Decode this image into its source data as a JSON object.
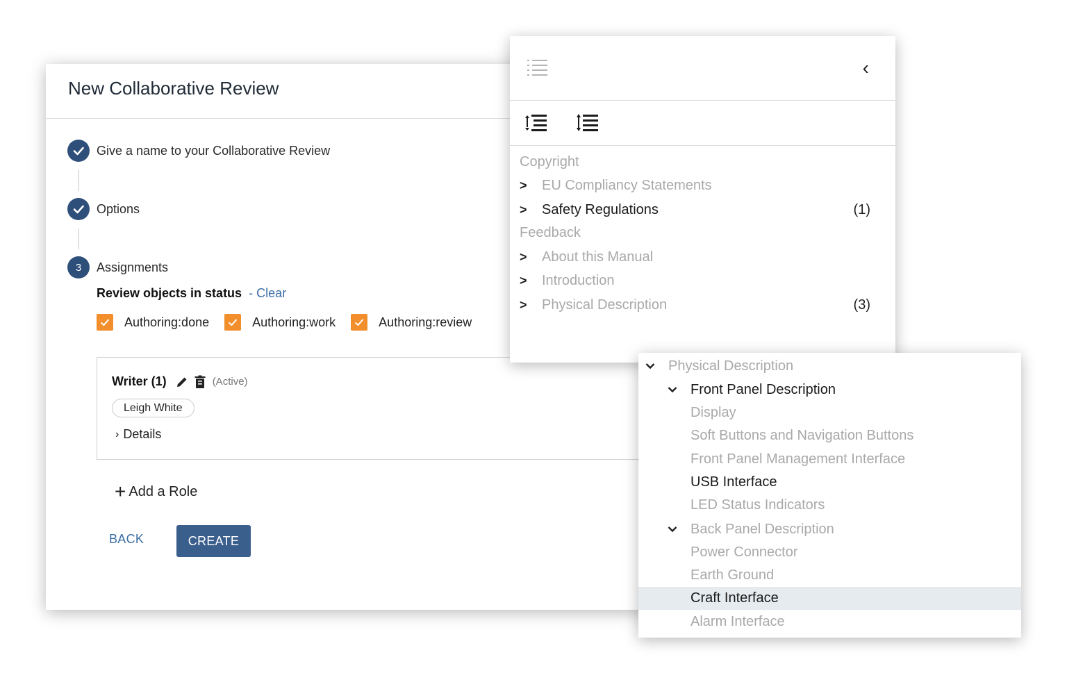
{
  "dialog": {
    "title": "New Collaborative Review",
    "steps": [
      {
        "label": "Give a name to your Collaborative Review",
        "state": "done"
      },
      {
        "label": "Options",
        "state": "done"
      },
      {
        "label": "Assignments",
        "state": "current",
        "number": "3"
      }
    ],
    "status_filter": {
      "label": "Review objects in status",
      "clear": "- Clear",
      "options": [
        {
          "label": "Authoring:done",
          "checked": true
        },
        {
          "label": "Authoring:work",
          "checked": true
        },
        {
          "label": "Authoring:review",
          "checked": true
        }
      ]
    },
    "role": {
      "title": "Writer (1)",
      "state": "(Active)",
      "assignee": "Leigh White",
      "details": "Details"
    },
    "add_role": "Add a Role",
    "back": "BACK",
    "create": "CREATE",
    "accent_color": "#2e4f7a",
    "checkbox_color": "#f28f2c"
  },
  "toc": {
    "icons": [
      "list-icon",
      "collapse-left-icon",
      "decrease-indent-icon",
      "increase-indent-icon"
    ],
    "items": [
      {
        "label": "Copyright",
        "level": 0,
        "style": "muted",
        "expandable": false,
        "count": ""
      },
      {
        "label": "EU Compliancy Statements",
        "level": 1,
        "style": "muted",
        "expandable": true,
        "count": ""
      },
      {
        "label": "Safety Regulations",
        "level": 1,
        "style": "dark",
        "expandable": true,
        "count": "(1)"
      },
      {
        "label": "Feedback",
        "level": 0,
        "style": "muted",
        "expandable": false,
        "count": ""
      },
      {
        "label": "About this Manual",
        "level": 1,
        "style": "muted",
        "expandable": true,
        "count": ""
      },
      {
        "label": "Introduction",
        "level": 1,
        "style": "muted",
        "expandable": true,
        "count": ""
      },
      {
        "label": "Physical Description",
        "level": 1,
        "style": "muted",
        "expandable": true,
        "count": "(3)"
      }
    ]
  },
  "subtree": {
    "items": [
      {
        "label": "Physical Description",
        "level": 0,
        "style": "muted",
        "expanded": true
      },
      {
        "label": "Front Panel Description",
        "level": 1,
        "style": "dark",
        "expanded": true
      },
      {
        "label": "Display",
        "level": 2,
        "style": "muted"
      },
      {
        "label": "Soft Buttons and Navigation Buttons",
        "level": 2,
        "style": "muted"
      },
      {
        "label": "Front Panel Management Interface",
        "level": 2,
        "style": "muted"
      },
      {
        "label": "USB Interface",
        "level": 2,
        "style": "dark"
      },
      {
        "label": "LED Status Indicators",
        "level": 2,
        "style": "muted"
      },
      {
        "label": "Back Panel Description",
        "level": 1,
        "style": "muted",
        "expanded": true
      },
      {
        "label": "Power Connector",
        "level": 2,
        "style": "muted"
      },
      {
        "label": "Earth Ground",
        "level": 2,
        "style": "muted"
      },
      {
        "label": "Craft Interface",
        "level": 2,
        "style": "dark",
        "selected": true
      },
      {
        "label": "Alarm Interface",
        "level": 2,
        "style": "muted"
      }
    ]
  }
}
